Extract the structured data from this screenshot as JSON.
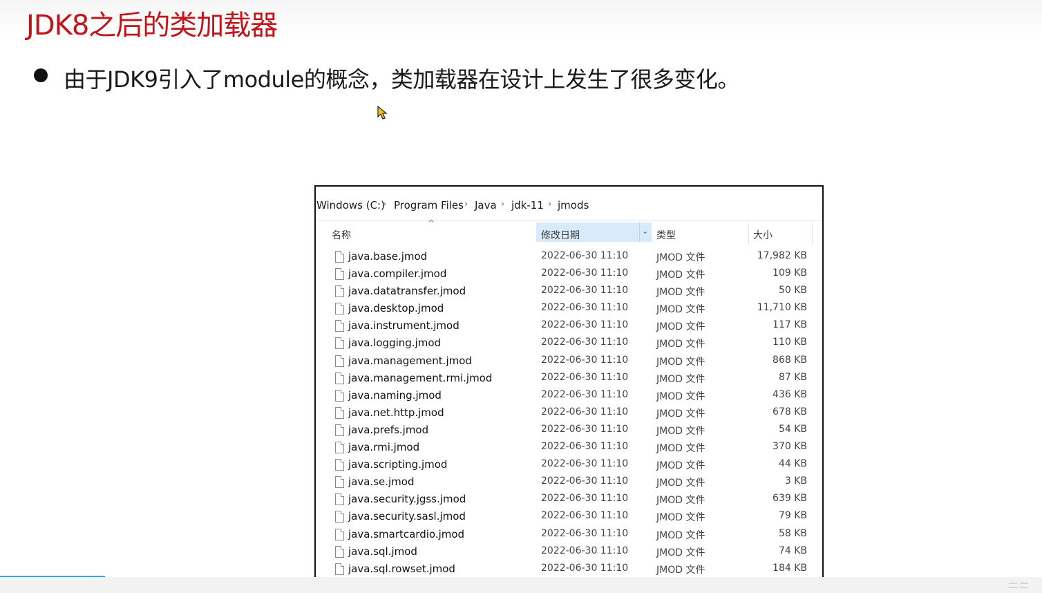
{
  "slide": {
    "title": "JDK8之后的类加载器",
    "bullet": "由于JDK9引入了module的概念，类加载器在设计上发生了很多变化。"
  },
  "explorer": {
    "breadcrumb": [
      "Windows (C:)",
      "Program Files",
      "Java",
      "jdk-11",
      "jmods"
    ],
    "columns": {
      "name": "名称",
      "date": "修改日期",
      "type": "类型",
      "size": "大小"
    },
    "sort_indicator": "^",
    "files": [
      {
        "name": "java.base.jmod",
        "date": "2022-06-30 11:10",
        "type": "JMOD 文件",
        "size": "17,982 KB"
      },
      {
        "name": "java.compiler.jmod",
        "date": "2022-06-30 11:10",
        "type": "JMOD 文件",
        "size": "109 KB"
      },
      {
        "name": "java.datatransfer.jmod",
        "date": "2022-06-30 11:10",
        "type": "JMOD 文件",
        "size": "50 KB"
      },
      {
        "name": "java.desktop.jmod",
        "date": "2022-06-30 11:10",
        "type": "JMOD 文件",
        "size": "11,710 KB"
      },
      {
        "name": "java.instrument.jmod",
        "date": "2022-06-30 11:10",
        "type": "JMOD 文件",
        "size": "117 KB"
      },
      {
        "name": "java.logging.jmod",
        "date": "2022-06-30 11:10",
        "type": "JMOD 文件",
        "size": "110 KB"
      },
      {
        "name": "java.management.jmod",
        "date": "2022-06-30 11:10",
        "type": "JMOD 文件",
        "size": "868 KB"
      },
      {
        "name": "java.management.rmi.jmod",
        "date": "2022-06-30 11:10",
        "type": "JMOD 文件",
        "size": "87 KB"
      },
      {
        "name": "java.naming.jmod",
        "date": "2022-06-30 11:10",
        "type": "JMOD 文件",
        "size": "436 KB"
      },
      {
        "name": "java.net.http.jmod",
        "date": "2022-06-30 11:10",
        "type": "JMOD 文件",
        "size": "678 KB"
      },
      {
        "name": "java.prefs.jmod",
        "date": "2022-06-30 11:10",
        "type": "JMOD 文件",
        "size": "54 KB"
      },
      {
        "name": "java.rmi.jmod",
        "date": "2022-06-30 11:10",
        "type": "JMOD 文件",
        "size": "370 KB"
      },
      {
        "name": "java.scripting.jmod",
        "date": "2022-06-30 11:10",
        "type": "JMOD 文件",
        "size": "44 KB"
      },
      {
        "name": "java.se.jmod",
        "date": "2022-06-30 11:10",
        "type": "JMOD 文件",
        "size": "3 KB"
      },
      {
        "name": "java.security.jgss.jmod",
        "date": "2022-06-30 11:10",
        "type": "JMOD 文件",
        "size": "639 KB"
      },
      {
        "name": "java.security.sasl.jmod",
        "date": "2022-06-30 11:10",
        "type": "JMOD 文件",
        "size": "79 KB"
      },
      {
        "name": "java.smartcardio.jmod",
        "date": "2022-06-30 11:10",
        "type": "JMOD 文件",
        "size": "58 KB"
      },
      {
        "name": "java.sql.jmod",
        "date": "2022-06-30 11:10",
        "type": "JMOD 文件",
        "size": "74 KB"
      },
      {
        "name": "java.sql.rowset.jmod",
        "date": "2022-06-30 11:10",
        "type": "JMOD 文件",
        "size": "184 KB"
      }
    ]
  },
  "colors": {
    "title": "#c0161b",
    "sorted_column_bg": "#d9eafb",
    "progress": "#2aa8ea"
  },
  "icons": [
    "file-icon",
    "chevron-right-icon",
    "chevron-down-icon",
    "mouse-cursor-icon",
    "menu-lines-icon"
  ]
}
